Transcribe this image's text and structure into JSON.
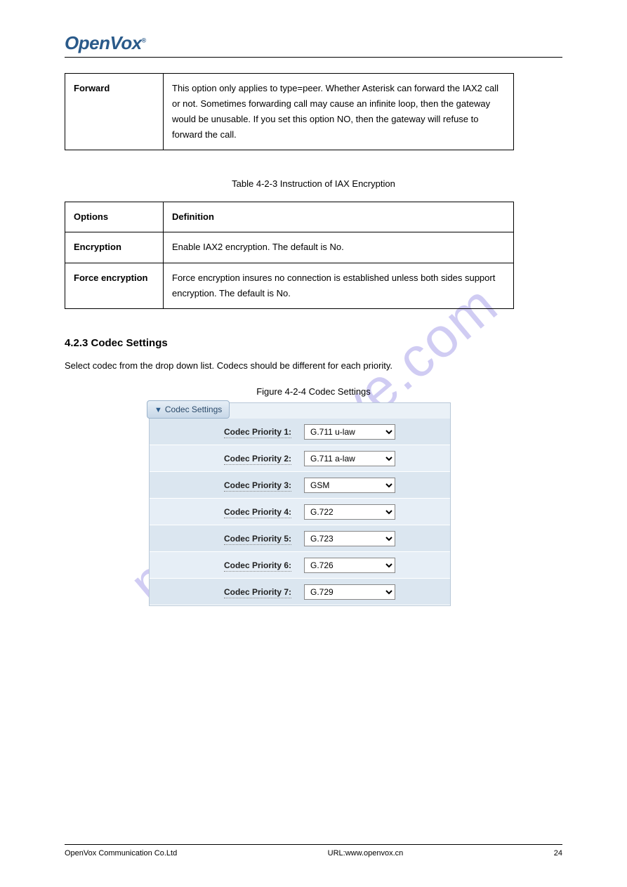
{
  "logo": {
    "open": "Open",
    "vox": "Vox",
    "reg": "®"
  },
  "table1": {
    "rows": [
      {
        "option": "Forward",
        "desc": "This option only applies to type=peer. Whether Asterisk can forward the IAX2 call or not. Sometimes forwarding call may cause an infinite loop, then the gateway would be unusable. If you set this option NO, then the gateway will refuse to forward the call."
      }
    ]
  },
  "table2_caption": "Table 4-2-3 Instruction of IAX Encryption",
  "table2": {
    "header": {
      "col1": "Options",
      "col2": "Definition"
    },
    "rows": [
      {
        "option": "Encryption",
        "desc": "Enable IAX2 encryption. The default is No."
      },
      {
        "option": "Force encryption",
        "desc": "Force encryption insures no connection is established unless both sides support encryption. The default is No."
      }
    ]
  },
  "section_heading": "4.2.3 Codec Settings",
  "section_body": "Select codec from the drop down list. Codecs should be different for each priority.",
  "fig_caption": "Figure 4-2-4 Codec Settings",
  "panel": {
    "title": "Codec Settings",
    "rows": [
      {
        "label": "Codec Priority 1:",
        "value": "G.711 u-law"
      },
      {
        "label": "Codec Priority 2:",
        "value": "G.711 a-law"
      },
      {
        "label": "Codec Priority 3:",
        "value": "GSM"
      },
      {
        "label": "Codec Priority 4:",
        "value": "G.722"
      },
      {
        "label": "Codec Priority 5:",
        "value": "G.723"
      },
      {
        "label": "Codec Priority 6:",
        "value": "G.726"
      },
      {
        "label": "Codec Priority 7:",
        "value": "G.729"
      }
    ]
  },
  "footer": {
    "left": "OpenVox Communication Co.Ltd",
    "center": "URL:www.openvox.cn",
    "right": "24"
  },
  "watermark": "manualshive.com"
}
